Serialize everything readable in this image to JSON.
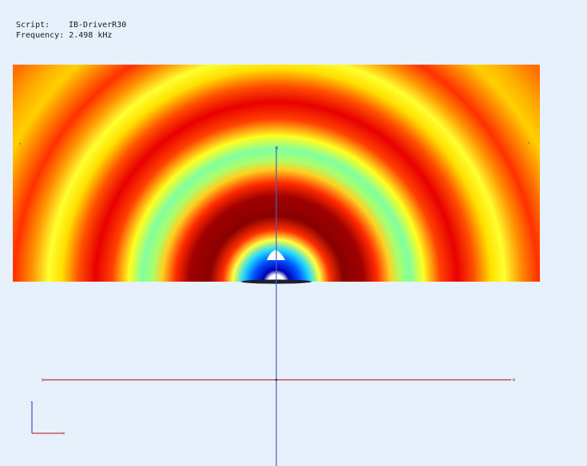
{
  "info": {
    "script_label": "Script:",
    "script_value": "IB-DriverR30",
    "frequency_label": "Frequency:",
    "frequency_value": "2.498 kHz"
  },
  "field_plot": {
    "type": "heatmap",
    "colormap": "jet",
    "pattern": "concentric half-rings around a driver source at bottom center"
  },
  "colors": {
    "background": "#e6f1fb",
    "vertical_axis": "#4b5fb8",
    "horizontal_axis": "#c0303a",
    "triad_y": "#3a4fd0",
    "triad_x": "#d03040"
  }
}
